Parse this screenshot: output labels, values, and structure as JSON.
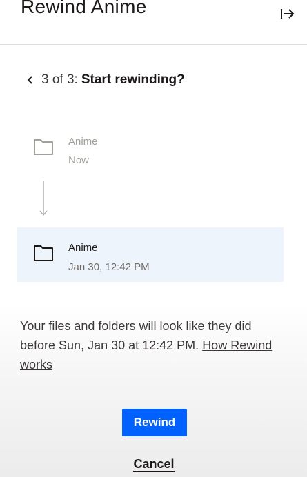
{
  "header": {
    "title": "Rewind Anime",
    "exit_icon": "exit-arrow-icon"
  },
  "step": {
    "back_icon": "chevron-left-icon",
    "count": "3 of 3:",
    "title": "Start rewinding?"
  },
  "timeline": {
    "current": {
      "icon": "folder-icon",
      "name": "Anime",
      "date": "Now"
    },
    "arrow_icon": "arrow-down-icon",
    "target": {
      "icon": "folder-icon",
      "name": "Anime",
      "date": "Jan 30, 12:42 PM"
    }
  },
  "description": {
    "text": "Your files and folders will look like they did before Sun, Jan 30 at 12:42 PM.",
    "link": "How Rewind works"
  },
  "actions": {
    "rewind_label": "Rewind",
    "cancel_label": "Cancel"
  },
  "colors": {
    "accent": "#0061fe",
    "selected_row": "#eef4fc",
    "text": "#1e1919",
    "muted": "#a3a09b"
  }
}
